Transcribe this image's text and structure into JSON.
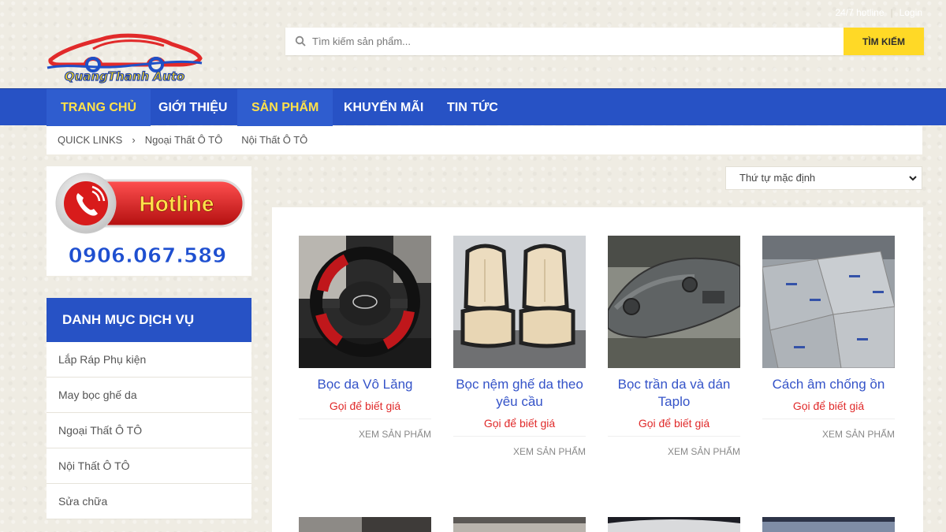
{
  "top_links": {
    "account": "24/7 hotline",
    "login": "Login"
  },
  "logo": {
    "text": "QuangThanh Auto",
    "colors": {
      "car": "#e12a2a",
      "wheel": "#1e50c8",
      "text_fill": "#f4d21b"
    }
  },
  "search": {
    "placeholder": "Tìm kiếm sản phẩm...",
    "button": "TÌM KIẾM",
    "icon": "search-icon"
  },
  "nav": {
    "items": [
      {
        "label": "TRANG CHỦ",
        "active": true
      },
      {
        "label": "GIỚI THIỆU",
        "active": false
      },
      {
        "label": "SẢN PHẨM",
        "active": true
      },
      {
        "label": "KHUYẾN MÃI",
        "active": false
      },
      {
        "label": "TIN TỨC",
        "active": false
      }
    ]
  },
  "quick_links": {
    "label": "QUICK LINKS",
    "items": [
      "Ngoại Thất Ô TÔ",
      "Nội Thất Ô TÔ"
    ]
  },
  "hotline": {
    "label": "Hotline",
    "phone": "0906.067.589"
  },
  "categories": {
    "title": "DANH MỤC DỊCH VỤ",
    "items": [
      "Lắp Ráp Phụ kiện",
      "May bọc ghế da",
      "Ngoại Thất Ô TÔ",
      "Nội Thất Ô TÔ",
      "Sửa chữa"
    ]
  },
  "sort": {
    "selected": "Thứ tự mặc định"
  },
  "products": [
    {
      "title": "Bọc da Vô Lăng",
      "price": "Gọi để biết giá",
      "action": "XEM SẢN PHẨM"
    },
    {
      "title": "Bọc nệm ghế da theo yêu cầu",
      "price": "Gọi để biết giá",
      "action": "XEM SẢN PHẨM"
    },
    {
      "title": "Bọc trần da và dán Taplo",
      "price": "Gọi để biết giá",
      "action": "XEM SẢN PHẨM"
    },
    {
      "title": "Cách âm chống ồn",
      "price": "Gọi để biết giá",
      "action": "XEM SẢN PHẨM"
    }
  ],
  "colors": {
    "brand_blue": "#2752c5",
    "accent_yellow": "#ffd926",
    "price_red": "#e02a2a",
    "link_blue": "#3453c8"
  }
}
